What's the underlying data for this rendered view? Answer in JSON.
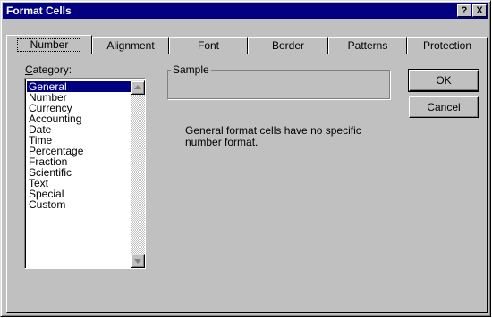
{
  "window": {
    "title": "Format Cells",
    "help_glyph": "?",
    "close_glyph": "X"
  },
  "tabs": [
    {
      "label": "Number",
      "active": true
    },
    {
      "label": "Alignment",
      "active": false
    },
    {
      "label": "Font",
      "active": false
    },
    {
      "label": "Border",
      "active": false
    },
    {
      "label": "Patterns",
      "active": false
    },
    {
      "label": "Protection",
      "active": false
    }
  ],
  "category": {
    "label_prefix": "C",
    "label_rest": "ategory:",
    "items": [
      "General",
      "Number",
      "Currency",
      "Accounting",
      "Date",
      "Time",
      "Percentage",
      "Fraction",
      "Scientific",
      "Text",
      "Special",
      "Custom"
    ],
    "selected": "General"
  },
  "sample": {
    "label": "Sample"
  },
  "description": "General format cells have no specific number format.",
  "buttons": {
    "ok": "OK",
    "cancel": "Cancel"
  },
  "colors": {
    "titlebar": "#000080",
    "dialog_face": "#c0c0c0",
    "selection": "#000080"
  },
  "icons": {
    "scroll_up": "up-arrow-icon",
    "scroll_down": "down-arrow-icon"
  }
}
